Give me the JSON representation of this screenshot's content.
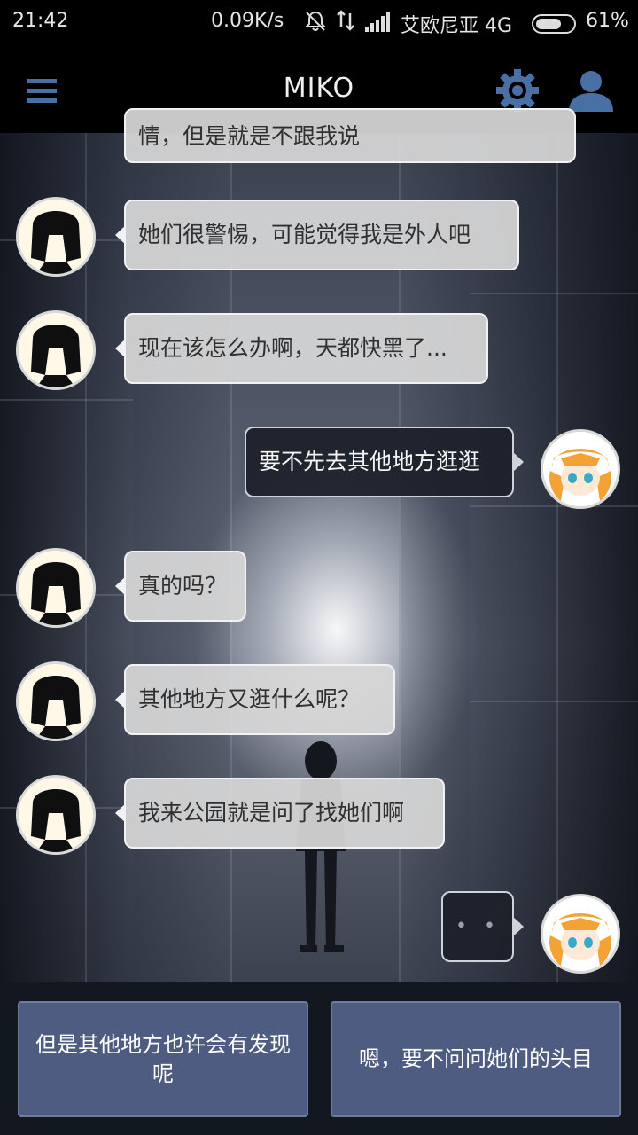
{
  "status_bar": {
    "time": "21:42",
    "network_speed": "0.09K/s",
    "carrier": "艾欧尼亚 4G",
    "battery": "61%",
    "icons": [
      "bell-off-icon",
      "data-arrows-icon",
      "signal-icon",
      "battery-icon"
    ]
  },
  "header": {
    "title": "MIKO",
    "icons": [
      "menu-icon",
      "gear-icon",
      "user-icon"
    ],
    "icon_color": "#4a6fa5"
  },
  "messages": [
    {
      "side": "left",
      "text": "情，但是就是不跟我说",
      "partial": true
    },
    {
      "side": "left",
      "text": "她们很警惕，可能觉得我是外人吧"
    },
    {
      "side": "left",
      "text": "现在该怎么办啊，天都快黑了..."
    },
    {
      "side": "right",
      "text": "要不先去其他地方逛逛"
    },
    {
      "side": "left",
      "text": "真的吗？"
    },
    {
      "side": "left",
      "text": "其他地方又逛什么呢？"
    },
    {
      "side": "left",
      "text": "我来公园就是问了找她们啊"
    },
    {
      "side": "right",
      "text": "• • •",
      "typing": true
    }
  ],
  "choices": [
    {
      "label": "但是其他地方也许会有发现呢"
    },
    {
      "label": "嗯，要不问问她们的头目"
    }
  ],
  "colors": {
    "choice_bg": "#4d5c80",
    "left_bubble": "#d7d7d7",
    "right_bubble": "#1c202a"
  }
}
